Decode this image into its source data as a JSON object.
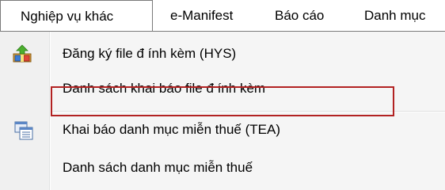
{
  "menubar": {
    "tabs": [
      {
        "label": "Nghiệp vụ khác",
        "active": true
      },
      {
        "label": "e-Manifest"
      },
      {
        "label": "Báo cáo"
      },
      {
        "label": "Danh mục"
      }
    ]
  },
  "dropdown": {
    "items": [
      {
        "label": "Đăng ký file đ ính kèm (HYS)",
        "icon": "attach-file-icon"
      },
      {
        "label": "Danh sách khai báo file đ ính kèm",
        "icon": null
      },
      {
        "label": "Khai báo danh mục miễn thuế (TEA)",
        "icon": "list-window-icon",
        "highlighted": true
      },
      {
        "label": "Danh sách danh mục miễn thuế",
        "icon": null
      }
    ]
  },
  "colors": {
    "highlight_border": "#b22222",
    "menu_background": "#f5f5f5",
    "tab_border": "#7a7a7a"
  }
}
